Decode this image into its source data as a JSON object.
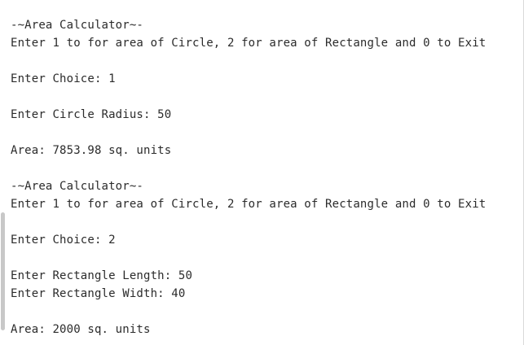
{
  "console": {
    "lines": [
      "-~Area Calculator~-",
      "Enter 1 to for area of Circle, 2 for area of Rectangle and 0 to Exit",
      "",
      "Enter Choice: 1",
      "",
      "Enter Circle Radius: 50",
      "",
      "Area: 7853.98 sq. units",
      "",
      "-~Area Calculator~-",
      "Enter 1 to for area of Circle, 2 for area of Rectangle and 0 to Exit",
      "",
      "Enter Choice: 2",
      "",
      "Enter Rectangle Length: 50",
      "Enter Rectangle Width: 40",
      "",
      "Area: 2000 sq. units"
    ]
  }
}
